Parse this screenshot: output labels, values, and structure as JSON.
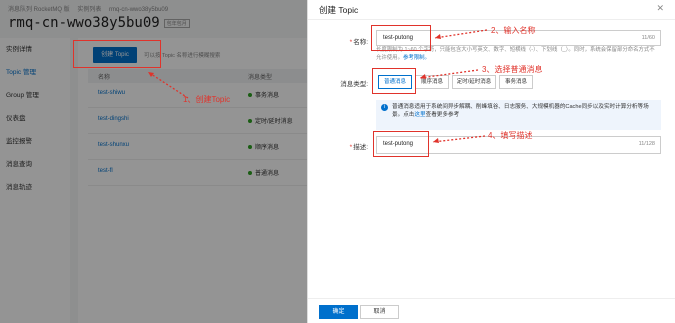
{
  "breadcrumb": [
    "消息队列 RocketMQ 版",
    "实例列表",
    "rmq-cn-wwo38y5bu09"
  ],
  "page_title": "rmq-cn-wwo38y5bu09",
  "page_title_badge": "包年包月",
  "sidebar": {
    "items": [
      {
        "label": "实例详情"
      },
      {
        "label": "Topic 管理"
      },
      {
        "label": "Group 管理"
      },
      {
        "label": "仪表盘"
      },
      {
        "label": "监控报警"
      },
      {
        "label": "消息查询"
      },
      {
        "label": "消息轨迹"
      }
    ]
  },
  "topic_list": {
    "create_label": "创建 Topic",
    "search_hint": "可以按 Topic 名称进行模糊搜索",
    "columns": [
      "名称",
      "消息类型"
    ],
    "rows": [
      {
        "name": "test-shiwu",
        "type": "事务消息"
      },
      {
        "name": "test-dingshi",
        "type": "定时/延时消息"
      },
      {
        "name": "test-shunxu",
        "type": "顺序消息"
      },
      {
        "name": "test-fl",
        "type": "普通消息"
      }
    ]
  },
  "annotations": {
    "step1": "1、创建Topic",
    "step2": "2、输入名称",
    "step3": "3、选择普通消息",
    "step4": "4、填写描述"
  },
  "drawer": {
    "title": "创建 Topic",
    "name_label": "名称:",
    "name_value": "test-putong",
    "name_count": "11/60",
    "name_help": "长度限制为 1~60 个字符，只能包含大小写英文、数字、短横线（-）、下划线（_）。同时，系统会保留部分命名方式不允许使用。",
    "name_help_link": "参考限制。",
    "type_label": "消息类型:",
    "types": [
      "普通消息",
      "顺序消息",
      "定时/延时消息",
      "事务消息"
    ],
    "info_text": "普通消息适用于系统间异步解耦、削峰填谷、日志服务、大规模机器的Cache同步以及实时计算分析等场景。点击",
    "info_link": "这里",
    "info_tail": "查看更多参考",
    "desc_label": "描述:",
    "desc_value": "test-putong",
    "desc_count": "11/128",
    "ok_label": "确定",
    "cancel_label": "取消"
  },
  "colors": {
    "accent": "#0070cc",
    "annotation": "#e0332b",
    "status": "#2ea121"
  }
}
